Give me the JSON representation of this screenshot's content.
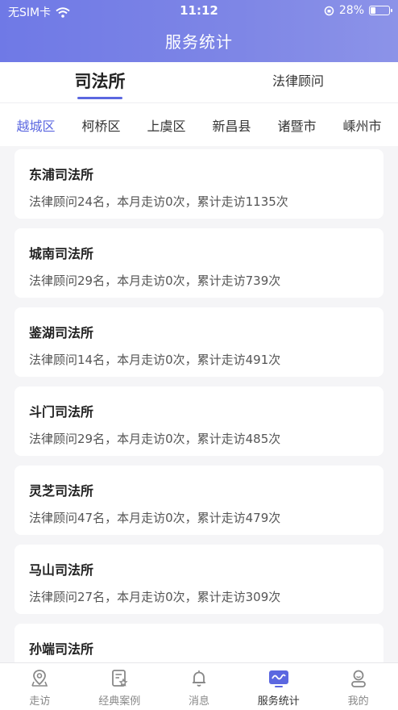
{
  "status_bar": {
    "carrier": "无SIM卡",
    "time": "11:12",
    "battery_text": "28%",
    "battery_level": 0.28
  },
  "header": {
    "title": "服务统计"
  },
  "main_tabs": [
    {
      "label": "司法所",
      "active": true
    },
    {
      "label": "法律顾问",
      "active": false
    }
  ],
  "districts": [
    {
      "label": "越城区",
      "active": true
    },
    {
      "label": "柯桥区",
      "active": false
    },
    {
      "label": "上虞区",
      "active": false
    },
    {
      "label": "新昌县",
      "active": false
    },
    {
      "label": "诸暨市",
      "active": false
    },
    {
      "label": "嵊州市",
      "active": false
    }
  ],
  "offices": [
    {
      "name": "东浦司法所",
      "stat": "法律顾问24名，本月走访0次，累计走访1135次"
    },
    {
      "name": "城南司法所",
      "stat": "法律顾问29名，本月走访0次，累计走访739次"
    },
    {
      "name": "鉴湖司法所",
      "stat": "法律顾问14名，本月走访0次，累计走访491次"
    },
    {
      "name": "斗门司法所",
      "stat": "法律顾问29名，本月走访0次，累计走访485次"
    },
    {
      "name": "灵芝司法所",
      "stat": "法律顾问47名，本月走访0次，累计走访479次"
    },
    {
      "name": "马山司法所",
      "stat": "法律顾问27名，本月走访0次，累计走访309次"
    },
    {
      "name": "孙端司法所",
      "stat": ""
    }
  ],
  "bottom_nav": [
    {
      "label": "走访",
      "icon": "map-pin-icon",
      "active": false
    },
    {
      "label": "经典案例",
      "icon": "document-star-icon",
      "active": false
    },
    {
      "label": "消息",
      "icon": "bell-icon",
      "active": false
    },
    {
      "label": "服务统计",
      "icon": "chart-wave-icon",
      "active": true
    },
    {
      "label": "我的",
      "icon": "user-icon",
      "active": false
    }
  ],
  "colors": {
    "accent": "#5b67e0",
    "header_gradient_start": "#6f79e6",
    "header_gradient_end": "#8c93e8"
  }
}
